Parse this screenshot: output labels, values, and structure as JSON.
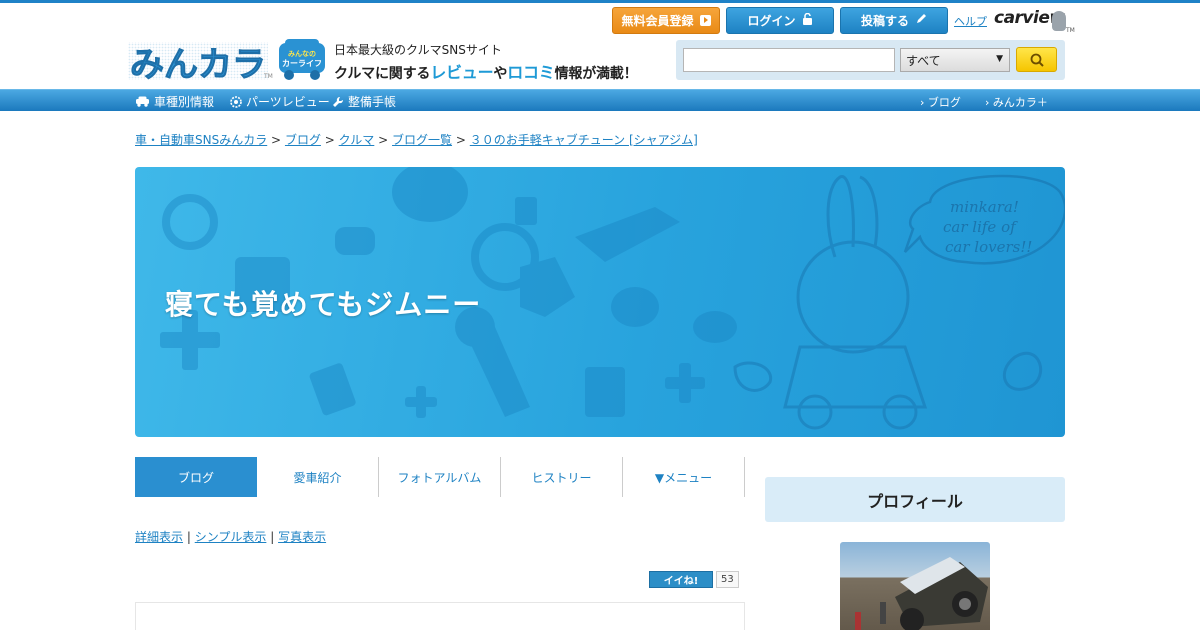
{
  "header": {
    "logo_text": "みんカラ",
    "logo_tm": "TM",
    "badge": "みんなのカーライフ",
    "tagline_top": "日本最大級のクルマSNSサイト",
    "tagline_pre": "クルマに関する",
    "tagline_review": "レビュー",
    "tagline_mid": "や",
    "tagline_kuchikomi": "ロコミ",
    "tagline_post": "情報が満載！",
    "buttons": {
      "register": "無料会員登録",
      "login": "ログイン",
      "post": "投稿する"
    },
    "help": "ヘルプ",
    "carview": "carview",
    "carview_tm": "TM",
    "search": {
      "value": "",
      "scope": "すべて"
    }
  },
  "nav": {
    "items": [
      "車種別情報",
      "パーツレビュー",
      "整備手帳"
    ],
    "right": [
      "ブログ",
      "みんカラ＋"
    ]
  },
  "breadcrumb": {
    "items": [
      "車・自動車SNSみんカラ",
      "ブログ",
      "クルマ",
      "ブログ一覧",
      "３０のお手軽キャブチューン [シャアジム]"
    ],
    "separator": ">"
  },
  "banner": {
    "title": "寝ても覚めてもジムニー",
    "speech": [
      "minkara!",
      "car life of",
      "car lovers!!"
    ]
  },
  "tabs": [
    {
      "label": "ブログ",
      "active": true
    },
    {
      "label": "愛車紹介",
      "active": false
    },
    {
      "label": "フォトアルバム",
      "active": false
    },
    {
      "label": "ヒストリー",
      "active": false
    },
    {
      "label": "▼メニュー",
      "active": false
    }
  ],
  "view_links": [
    "詳細表示",
    "シンプル表示",
    "写真表示"
  ],
  "view_sep": "|",
  "iine": {
    "label": "イイね!",
    "count": "53"
  },
  "sidebar": {
    "profile_title": "プロフィール"
  },
  "colors": {
    "primary": "#1e82c3",
    "banner": "#28a3dd",
    "register": "#e98a16",
    "search_button": "#f6c500",
    "profile_bg": "#d9ecf8"
  }
}
